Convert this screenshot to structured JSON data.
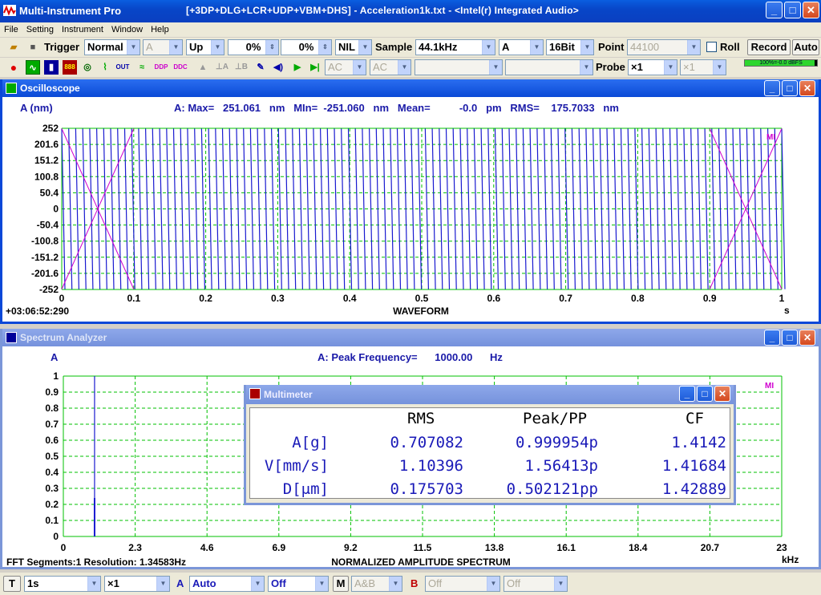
{
  "window": {
    "title": "Multi-Instrument Pro",
    "subtitle": "[+3DP+DLG+LCR+UDP+VBM+DHS]   -   Acceleration1k.txt   -   <Intel(r) Integrated Audio>"
  },
  "menu": [
    "File",
    "Setting",
    "Instrument",
    "Window",
    "Help"
  ],
  "toolbar1": {
    "trigger_label": "Trigger",
    "trigger_mode": "Normal",
    "trigger_channel": "A",
    "trigger_edge": "Up",
    "trigger_level": "0%",
    "trigger_delay": "0%",
    "trigger_nil": "NIL",
    "sample_label": "Sample",
    "sample_rate": "44.1kHz",
    "channel": "A",
    "bits": "16Bit",
    "point_label": "Point",
    "point_value": "44100",
    "roll_label": "Roll",
    "record_label": "Record",
    "auto_label": "Auto"
  },
  "toolbar2": {
    "coupling_a": "AC",
    "coupling_b": "AC",
    "probe_label": "Probe",
    "probe_a": "×1",
    "probe_b": "×1",
    "level_meter_text": "100%=-0.0 dBFS",
    "level_meter_fraction": 0.97
  },
  "oscilloscope": {
    "title": "Oscilloscope",
    "channel_label": "A (nm)",
    "stats": "A: Max=   251.061   nm   MIn=  -251.060   nm   Mean=          -0.0   pm   RMS=    175.7033   nm",
    "timestamp": "+03:06:52:290",
    "x_unit": "s",
    "logo": "MI"
  },
  "spectrum": {
    "title": "Spectrum Analyzer",
    "channel_label": "A",
    "peak_text": "A: Peak Frequency=      1000.00      Hz",
    "fft_info": "FFT Segments:1   Resolution: 1.34583Hz",
    "x_unit": "kHz",
    "logo": "MI"
  },
  "multimeter": {
    "title": "Multimeter",
    "headers": [
      "RMS",
      "Peak/PP",
      "CF"
    ],
    "rows": [
      {
        "label": "A[g]",
        "rms": "0.707082",
        "peak": "0.999954p",
        "cf": "1.4142"
      },
      {
        "label": "V[mm/s]",
        "rms": "1.10396",
        "peak": "1.56413p",
        "cf": "1.41684"
      },
      {
        "label": "D[μm]",
        "rms": "0.175703",
        "peak": "0.502121pp",
        "cf": "1.42889"
      }
    ]
  },
  "statusbar": {
    "t_label": "T",
    "timebase": "1s",
    "time_mult": "×1",
    "a_label": "A",
    "a_range": "Auto",
    "a_offset": "Off",
    "m_label": "M",
    "m_mode": "A&B",
    "b_label": "B",
    "b_range": "Off",
    "b_offset": "Off"
  },
  "colors": {
    "trace": "#1a1ad0",
    "grid": "#00c000",
    "envelope": "#d000d0",
    "header_text": "#1a1aa8"
  },
  "chart_data": [
    {
      "type": "line",
      "title": "WAVEFORM",
      "xlabel": "s",
      "ylabel": "A (nm)",
      "xlim": [
        0,
        1
      ],
      "ylim": [
        -252,
        252
      ],
      "x_ticks": [
        "0",
        "0.1",
        "0.2",
        "0.3",
        "0.4",
        "0.5",
        "0.6",
        "0.7",
        "0.8",
        "0.9",
        "1"
      ],
      "y_ticks": [
        "252",
        "201.6",
        "151.2",
        "100.8",
        "50.4",
        "0",
        "-50.4",
        "-100.8",
        "-151.2",
        "-201.6",
        "-252"
      ],
      "series": [
        {
          "amplitude": 251.06,
          "frequency_hz": 1000
        }
      ],
      "grid": true
    },
    {
      "type": "bar",
      "title": "NORMALIZED AMPLITUDE SPECTRUM",
      "xlabel": "kHz",
      "ylabel": "A",
      "xlim": [
        0,
        23
      ],
      "ylim": [
        0,
        1
      ],
      "x_ticks": [
        "0",
        "2.3",
        "4.6",
        "6.9",
        "9.2",
        "11.5",
        "13.8",
        "16.1",
        "18.4",
        "20.7",
        "23"
      ],
      "y_ticks": [
        "1",
        "0.9",
        "0.8",
        "0.7",
        "0.6",
        "0.5",
        "0.4",
        "0.3",
        "0.2",
        "0.1",
        "0"
      ],
      "peaks": [
        {
          "x": 1.0,
          "y": 1.0
        },
        {
          "x": 1.0,
          "y": 0.24
        }
      ],
      "grid": true
    }
  ]
}
